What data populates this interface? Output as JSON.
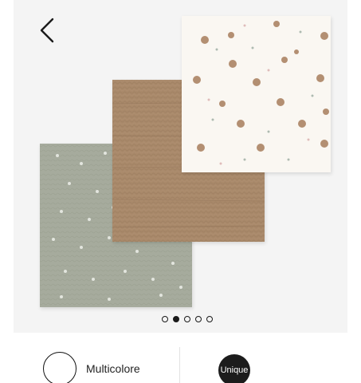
{
  "gallery": {
    "back_icon": "chevron-left-icon",
    "image_alt_description": "",
    "pagination": {
      "count": 5,
      "active_index": 1
    },
    "colors": {
      "background": "#f4f4f4",
      "sage_blanket": "#a5aa9c",
      "tan_blanket": "#a88a6c",
      "white_blanket": "#faf7f2"
    }
  },
  "options": {
    "color_label": "Multicolore",
    "size_label": "Unique"
  }
}
